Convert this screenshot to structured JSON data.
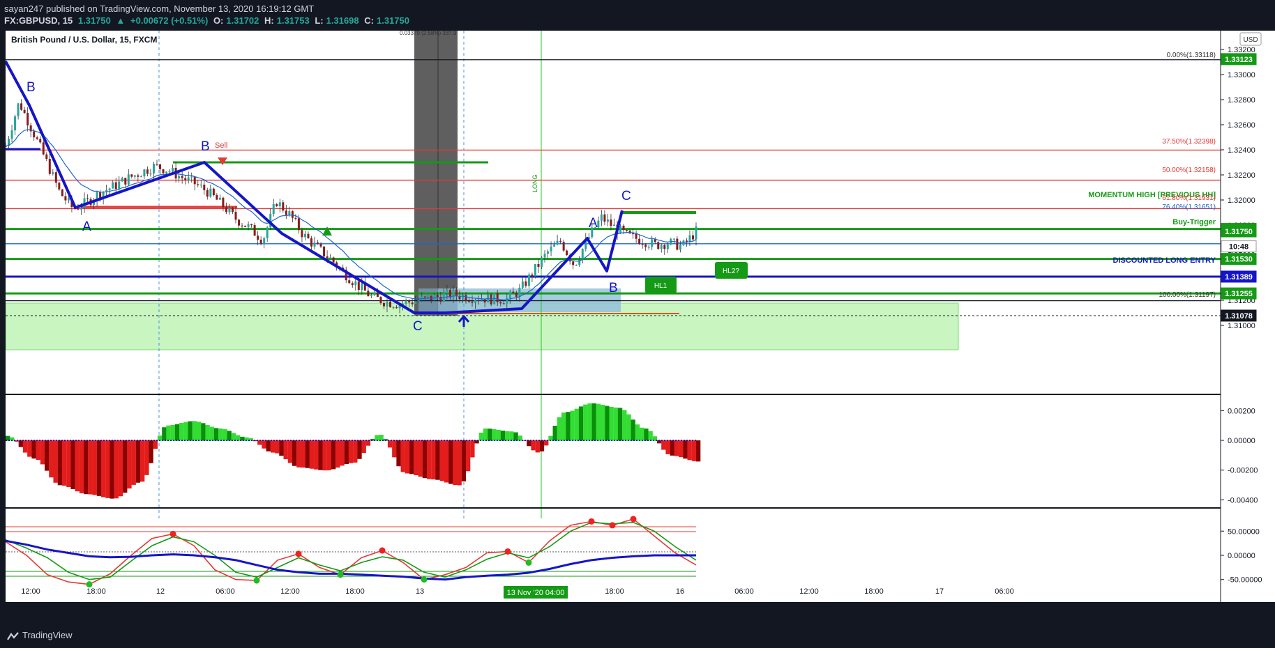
{
  "header": {
    "published_by": "sayan247 published on TradingView.com, November 13, 2020 16:19:12 GMT",
    "symbol": "FX:GBPUSD, 15",
    "last": "1.31750",
    "change": "+0.00672 (+0.51%)",
    "open_label": "O:",
    "open": "1.31702",
    "high_label": "H:",
    "high": "1.31753",
    "low_label": "L:",
    "low": "1.31698",
    "close_label": "C:",
    "close": "1.31750"
  },
  "chart_title": "British Pound / U.S. Dollar, 15, FXCM",
  "currency_button": "USD",
  "measure_label": "0.03379 (2.58%) 337.9",
  "sell_label": "Sell",
  "long_label": "LONG",
  "footer_logo": "TradingView",
  "colors": {
    "background": "#131722",
    "chart_bg": "#ffffff",
    "wave": "#1515c8",
    "green_line": "#159a15",
    "red_line": "#e53935",
    "blue_line": "#1e66d0",
    "zone": "#c8f5c0"
  },
  "annotations": {
    "wave_labels": [
      "B",
      "A",
      "B",
      "C",
      "A",
      "C",
      "B"
    ],
    "hl1": "HL1",
    "hl2": "HL2?",
    "momentum_high": "MOMENTUM HIGH [PREVIOUS HH]",
    "buy_trigger": "Buy-Trigger",
    "discounted_long": "DISCOUNTED LONG ENTRY",
    "fib": [
      "0.00%(1.33118)",
      "37.50%(1.32398)",
      "50.00%(1.32158)",
      "61.80%(1.31931)",
      "76.40%(1.31651)",
      "100.00%(1.31197)"
    ],
    "highlighted_time": "13 Nov '20   04:00"
  },
  "chart_data": [
    {
      "type": "candlestick",
      "title": "British Pound / U.S. Dollar, 15, FXCM",
      "ylim": [
        1.309,
        1.3335
      ],
      "y_ticks": [
        "1.31000",
        "1.31200",
        "1.31400",
        "1.31600",
        "1.31800",
        "1.32000",
        "1.32200",
        "1.32400",
        "1.32600",
        "1.32800",
        "1.33000",
        "1.33200"
      ],
      "price_tags": [
        {
          "value": "1.33123",
          "color": "#159a15"
        },
        {
          "value": "1.31769",
          "color": "#159a15"
        },
        {
          "value": "1.31750",
          "color": "#159a15"
        },
        {
          "value": "10:48",
          "color": "#ffffff"
        },
        {
          "value": "1.31530",
          "color": "#159a15"
        },
        {
          "value": "1.31389",
          "color": "#1515c8"
        },
        {
          "value": "1.31255",
          "color": "#159a15"
        },
        {
          "value": "1.31078",
          "color": "#131722"
        }
      ],
      "horizontal_levels": [
        {
          "value": 1.33118,
          "color": "#131722"
        },
        {
          "value": 1.32398,
          "color": "#e53935"
        },
        {
          "value": 1.32158,
          "color": "#e53935"
        },
        {
          "value": 1.31931,
          "color": "#e53935"
        },
        {
          "value": 1.31769,
          "color": "#159a15"
        },
        {
          "value": 1.31651,
          "color": "#1e66d0"
        },
        {
          "value": 1.3153,
          "color": "#159a15"
        },
        {
          "value": 1.31389,
          "color": "#1515c8"
        },
        {
          "value": 1.31255,
          "color": "#159a15"
        },
        {
          "value": 1.31197,
          "color": "#131722"
        }
      ],
      "x_ticks": [
        "12:00",
        "18:00",
        "12",
        "06:00",
        "12:00",
        "18:00",
        "13",
        "12:00",
        "18:00",
        "16",
        "06:00",
        "12:00",
        "18:00",
        "17",
        "06:00"
      ],
      "close_path": [
        1.3243,
        1.3278,
        1.3255,
        1.3231,
        1.3206,
        1.3193,
        1.3198,
        1.3206,
        1.3211,
        1.3217,
        1.3222,
        1.3227,
        1.3224,
        1.3218,
        1.3213,
        1.3206,
        1.3196,
        1.3185,
        1.3178,
        1.3168,
        1.3199,
        1.3188,
        1.3172,
        1.3162,
        1.3153,
        1.3142,
        1.3132,
        1.3123,
        1.3119,
        1.3117,
        1.3119,
        1.3121,
        1.3123,
        1.3125,
        1.3123,
        1.3122,
        1.3121,
        1.3121,
        1.3128,
        1.3143,
        1.3158,
        1.3167,
        1.3148,
        1.3169,
        1.3186,
        1.3178,
        1.3171,
        1.3168,
        1.3164,
        1.3166,
        1.3163,
        1.3175
      ]
    },
    {
      "type": "histogram",
      "title": "",
      "ylim": [
        -0.0045,
        0.003
      ],
      "y_ticks": [
        "0.00200",
        "0.00000",
        "-0.00200",
        "-0.00400"
      ],
      "values": [
        0.0003,
        -0.0012,
        -0.003,
        -0.0036,
        -0.0039,
        -0.0028,
        0.001,
        0.0013,
        0.0008,
        0.0002,
        -0.0008,
        -0.0018,
        -0.002,
        -0.0015,
        0.0004,
        -0.0022,
        -0.0026,
        -0.003,
        0.0008,
        0.0006,
        -0.0008,
        0.0019,
        0.0025,
        0.0022,
        0.0008,
        -0.001,
        -0.0014
      ]
    },
    {
      "type": "line",
      "title": "",
      "ylim": [
        -95,
        95
      ],
      "y_ticks": [
        "50.00000",
        "0.00000",
        "-50.00000"
      ],
      "series": [
        {
          "values": [
            28,
            0,
            -40,
            -55,
            -60,
            -38,
            0,
            35,
            44,
            20,
            -30,
            -50,
            -52,
            -10,
            3,
            -25,
            -40,
            -5,
            10,
            -15,
            -50,
            -40,
            -25,
            5,
            8,
            -15,
            30,
            62,
            70,
            62,
            75,
            40,
            5,
            -20
          ]
        },
        {
          "values": [
            32,
            15,
            -5,
            -35,
            -50,
            -45,
            -12,
            20,
            38,
            28,
            0,
            -35,
            -45,
            -25,
            -5,
            -20,
            -32,
            -15,
            -3,
            -10,
            -35,
            -45,
            -30,
            -8,
            5,
            -5,
            18,
            50,
            68,
            65,
            68,
            50,
            18,
            -10
          ]
        },
        {
          "values": [
            30,
            22,
            12,
            5,
            -2,
            -4,
            -3,
            0,
            2,
            0,
            -4,
            -10,
            -20,
            -30,
            -35,
            -38,
            -38,
            -40,
            -42,
            -44,
            -48,
            -50,
            -45,
            -42,
            -40,
            -36,
            -28,
            -18,
            -10,
            -5,
            -2,
            0,
            0,
            0
          ]
        }
      ]
    }
  ]
}
